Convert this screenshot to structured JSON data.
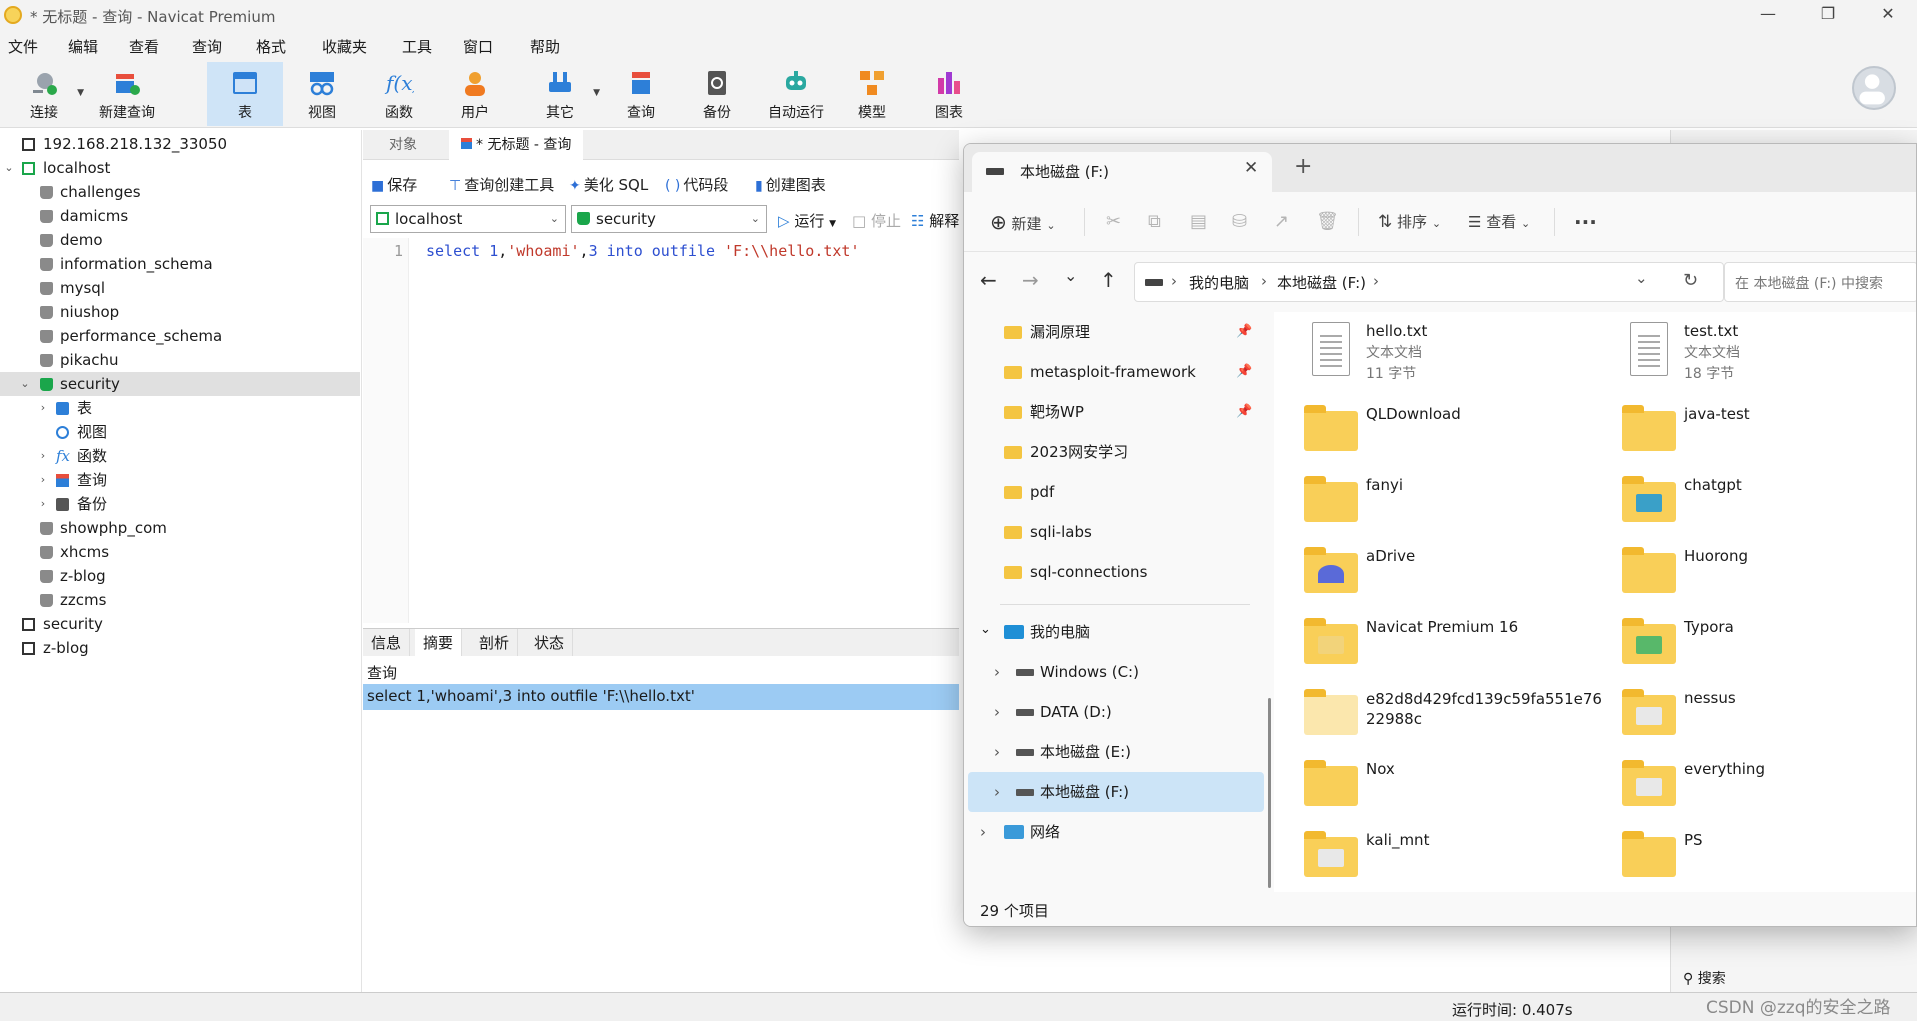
{
  "window": {
    "title": "* 无标题 - 查询 - Navicat Premium"
  },
  "menu": [
    "文件",
    "编辑",
    "查看",
    "查询",
    "格式",
    "收藏夹",
    "工具",
    "窗口",
    "帮助"
  ],
  "toolbar": {
    "connect": "连接",
    "new_query": "新建查询",
    "table": "表",
    "view": "视图",
    "function": "函数",
    "user": "用户",
    "other": "其它",
    "query": "查询",
    "backup": "备份",
    "auto_run": "自动运行",
    "model": "模型",
    "chart": "图表"
  },
  "tree": {
    "connections": [
      {
        "label": "192.168.218.132_33050"
      },
      {
        "label": "localhost"
      },
      {
        "label": "security"
      },
      {
        "label": "z-blog"
      }
    ],
    "databases": [
      "challenges",
      "damicms",
      "demo",
      "information_schema",
      "mysql",
      "niushop",
      "performance_schema",
      "pikachu",
      "security",
      "showphp_com",
      "xhcms",
      "z-blog",
      "zzcms"
    ],
    "security_children": [
      "表",
      "视图",
      "函数",
      "查询",
      "备份"
    ]
  },
  "tabs": {
    "objects": "对象",
    "query_tab": "* 无标题 - 查询"
  },
  "query_toolbar": {
    "save": "保存",
    "builder": "查询创建工具",
    "beautify": "美化 SQL",
    "snippet": "代码段",
    "create_chart": "创建图表",
    "run": "运行",
    "stop": "停止",
    "explain": "解释"
  },
  "selectors": {
    "connection": "localhost",
    "database": "security"
  },
  "editor": {
    "line_number": "1",
    "kw_select": "select",
    "num1": "1",
    "comma1": ",",
    "str_whoami": "'whoami'",
    "comma2": ",",
    "num3": "3",
    "kw_into": "into",
    "kw_outfile": "outfile",
    "str_path": "'F:\\\\hello.txt'"
  },
  "info_tabs": [
    "信息",
    "摘要",
    "剖析",
    "状态"
  ],
  "info": {
    "heading": "查询",
    "row": "select 1,'whoami',3 into outfile 'F:\\\\hello.txt'"
  },
  "status": {
    "runtime": "运行时间: 0.407s",
    "search": "搜索",
    "watermark": "CSDN @zzq的安全之路"
  },
  "explorer": {
    "tab_title": "本地磁盘 (F:)",
    "new_tab": "+",
    "new_label": "新建",
    "sort_label": "排序",
    "view_label": "查看",
    "more": "···",
    "breadcrumb": [
      "我的电脑",
      "本地磁盘 (F:)"
    ],
    "search_placeholder": "在 本地磁盘 (F:) 中搜索",
    "quick_access": [
      {
        "label": "漏洞原理",
        "pinned": true
      },
      {
        "label": "metasploit-framework",
        "pinned": true
      },
      {
        "label": "靶场WP",
        "pinned": true
      },
      {
        "label": "2023网安学习",
        "pinned": false
      },
      {
        "label": "pdf",
        "pinned": false
      },
      {
        "label": "sqli-labs",
        "pinned": false
      },
      {
        "label": "sql-connections",
        "pinned": false
      }
    ],
    "this_pc": "我的电脑",
    "drives": [
      "Windows (C:)",
      "DATA (D:)",
      "本地磁盘 (E:)",
      "本地磁盘 (F:)"
    ],
    "network": "网络",
    "files": [
      {
        "name": "hello.txt",
        "type": "文本文档",
        "size": "11 字节"
      },
      {
        "name": "test.txt",
        "type": "文本文档",
        "size": "18 字节"
      }
    ],
    "folders": [
      "QLDownload",
      "java-test",
      "fanyi",
      "chatgpt",
      "aDrive",
      "Huorong",
      "Navicat Premium 16",
      "Typora",
      "e82d8d429fcd139c59fa551e7622988c",
      "nessus",
      "Nox",
      "everything",
      "kali_mnt",
      "PS"
    ],
    "item_count": "29 个项目"
  }
}
